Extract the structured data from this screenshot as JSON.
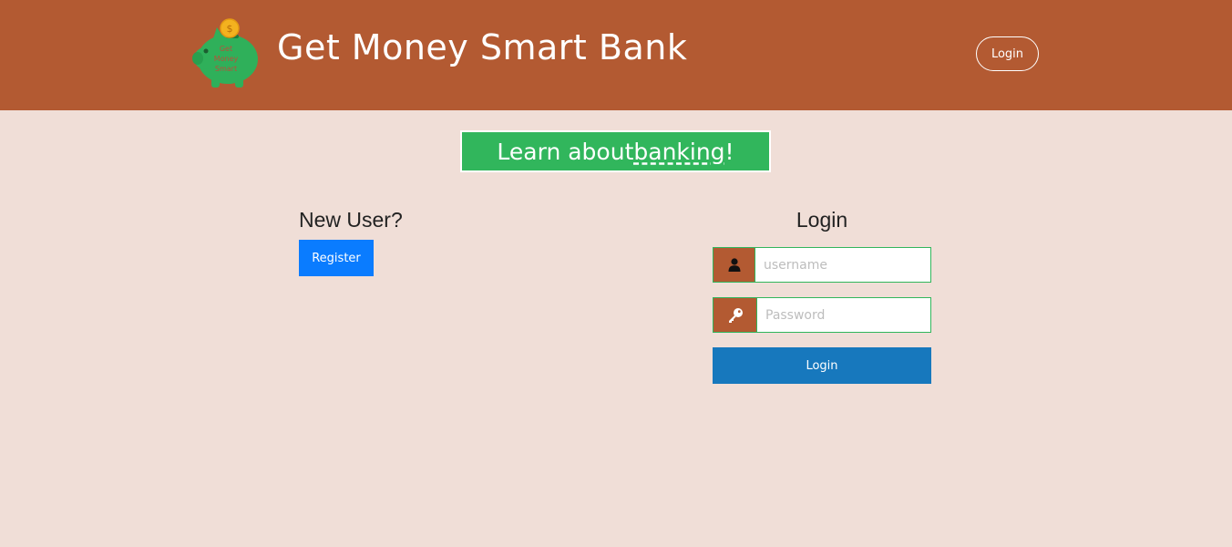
{
  "header": {
    "logo_text": [
      "Get",
      "Money",
      "Smart"
    ],
    "logo_coin_symbol": "$",
    "title": "Get Money Smart Bank",
    "login_button": "Login"
  },
  "banner": {
    "text_before": "Learn about ",
    "text_underlined": "banking",
    "text_after": "!"
  },
  "new_user": {
    "heading": "New User?",
    "register_button": "Register"
  },
  "login_form": {
    "heading": "Login",
    "username": {
      "placeholder": "username",
      "value": "",
      "icon": "user-icon"
    },
    "password": {
      "placeholder": "Password",
      "value": "",
      "icon": "key-icon"
    },
    "submit_button": "Login"
  },
  "colors": {
    "header_bg": "#b35a32",
    "page_bg": "#f0ded7",
    "banner_bg": "#31b65c",
    "register_bg": "#0a7cff",
    "login_bg": "#1778bd",
    "input_border": "#31b65c"
  }
}
